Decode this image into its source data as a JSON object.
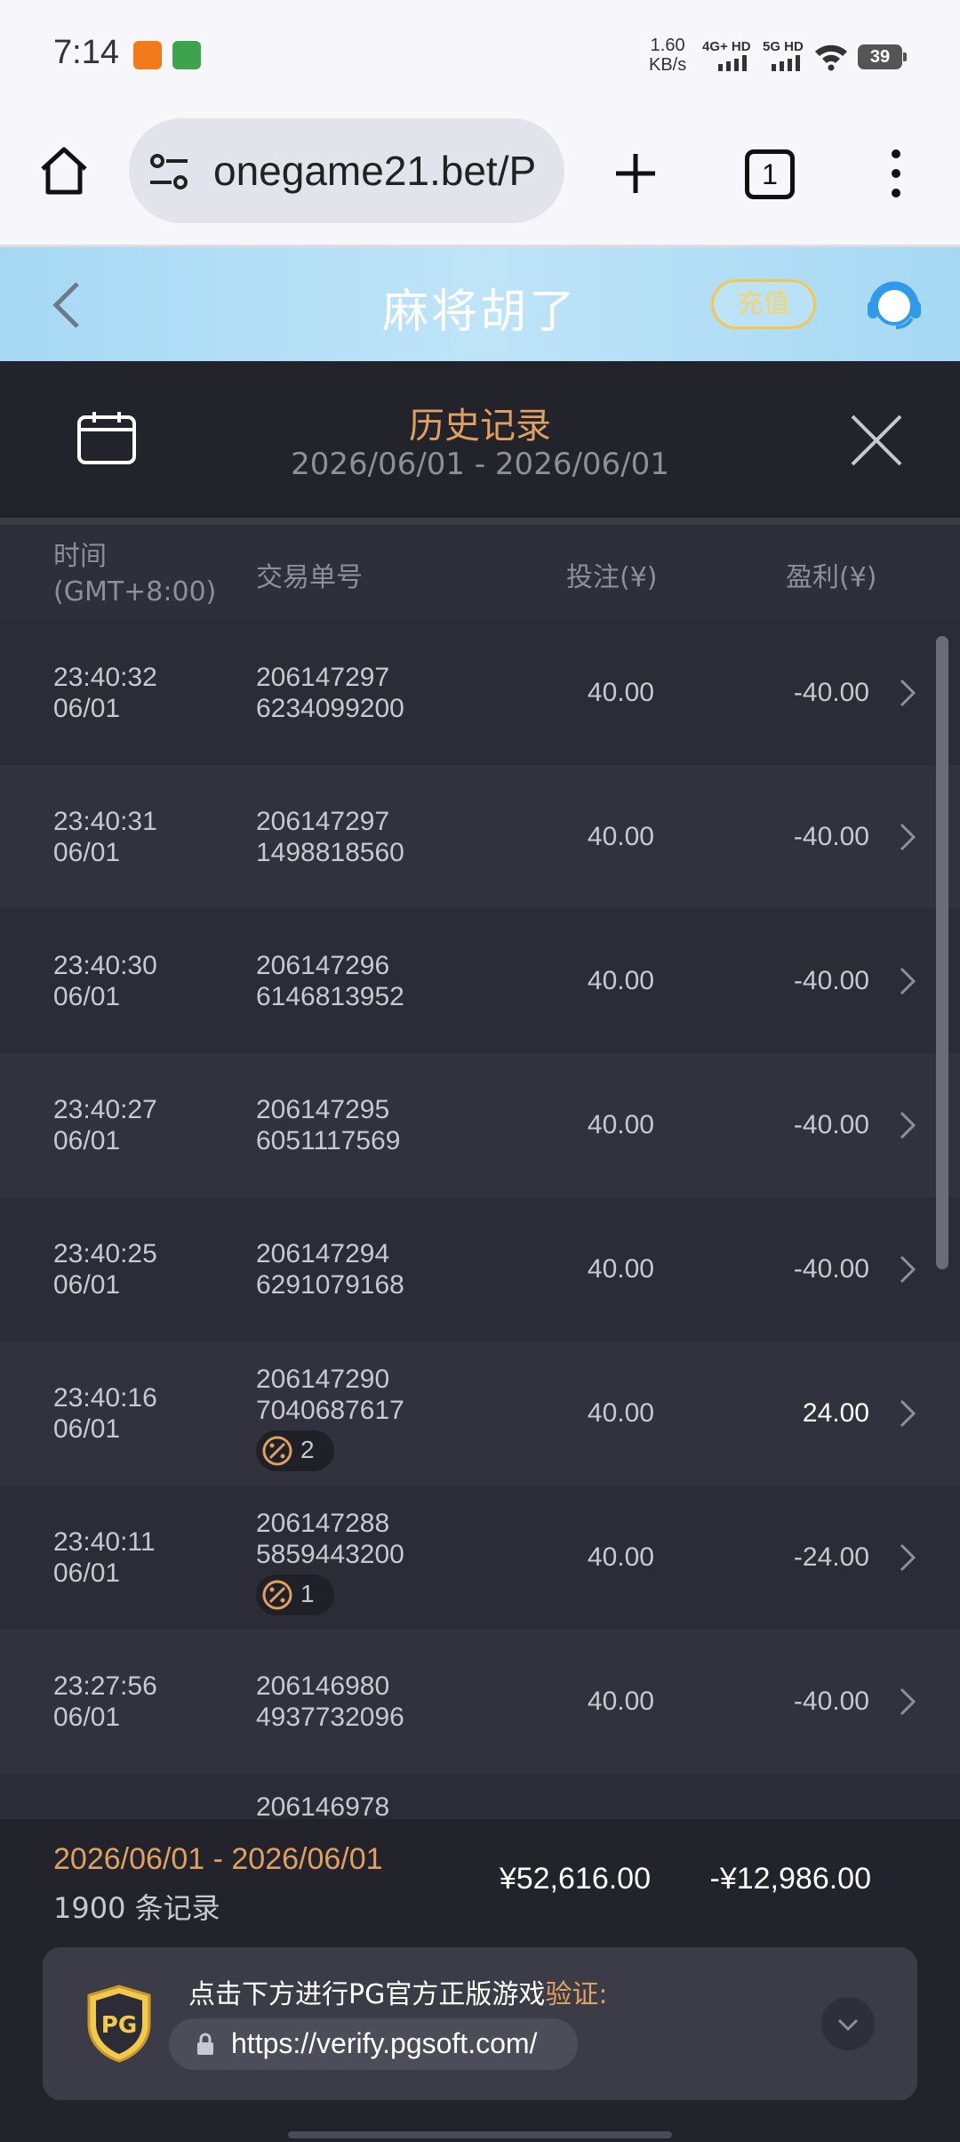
{
  "status_bar": {
    "time": "7:14",
    "net_speed_value": "1.60",
    "net_speed_unit": "KB/s",
    "signal1": "4G+ HD",
    "signal2": "5G HD",
    "battery": "39"
  },
  "browser": {
    "url": "onegame21.bet/P",
    "tab_count": "1"
  },
  "game": {
    "title": "麻将胡了",
    "recharge_label": "充值"
  },
  "history": {
    "title": "历史记录",
    "range": "2026/06/01 - 2026/06/01"
  },
  "columns": {
    "time": "时间",
    "timezone": "(GMT+8:00)",
    "order_id": "交易单号",
    "bet": "投注(¥)",
    "profit": "盈利(¥)"
  },
  "records": [
    {
      "time": "23:40:32",
      "date": "06/01",
      "id_line1": "206147297",
      "id_line2": "6234099200",
      "bet": "40.00",
      "profit": "-40.00",
      "badge": ""
    },
    {
      "time": "23:40:31",
      "date": "06/01",
      "id_line1": "206147297",
      "id_line2": "1498818560",
      "bet": "40.00",
      "profit": "-40.00",
      "badge": ""
    },
    {
      "time": "23:40:30",
      "date": "06/01",
      "id_line1": "206147296",
      "id_line2": "6146813952",
      "bet": "40.00",
      "profit": "-40.00",
      "badge": ""
    },
    {
      "time": "23:40:27",
      "date": "06/01",
      "id_line1": "206147295",
      "id_line2": "6051117569",
      "bet": "40.00",
      "profit": "-40.00",
      "badge": ""
    },
    {
      "time": "23:40:25",
      "date": "06/01",
      "id_line1": "206147294",
      "id_line2": "6291079168",
      "bet": "40.00",
      "profit": "-40.00",
      "badge": ""
    },
    {
      "time": "23:40:16",
      "date": "06/01",
      "id_line1": "206147290",
      "id_line2": "7040687617",
      "bet": "40.00",
      "profit": "24.00",
      "badge": "2"
    },
    {
      "time": "23:40:11",
      "date": "06/01",
      "id_line1": "206147288",
      "id_line2": "5859443200",
      "bet": "40.00",
      "profit": "-24.00",
      "badge": "1"
    },
    {
      "time": "23:27:56",
      "date": "06/01",
      "id_line1": "206146980",
      "id_line2": "4937732096",
      "bet": "40.00",
      "profit": "-40.00",
      "badge": ""
    },
    {
      "time": "",
      "date": "",
      "id_line1": "206146978",
      "id_line2": "",
      "bet": "",
      "profit": "",
      "badge": ""
    }
  ],
  "summary": {
    "range": "2026/06/01 - 2026/06/01",
    "count": "1900 条记录",
    "total_bet": "¥52,616.00",
    "total_profit": "-¥12,986.00"
  },
  "verify": {
    "text": "点击下方进行PG官方正版游戏",
    "accent": "验证:",
    "logo_text": "PG",
    "url": "https://verify.pgsoft.com/"
  }
}
